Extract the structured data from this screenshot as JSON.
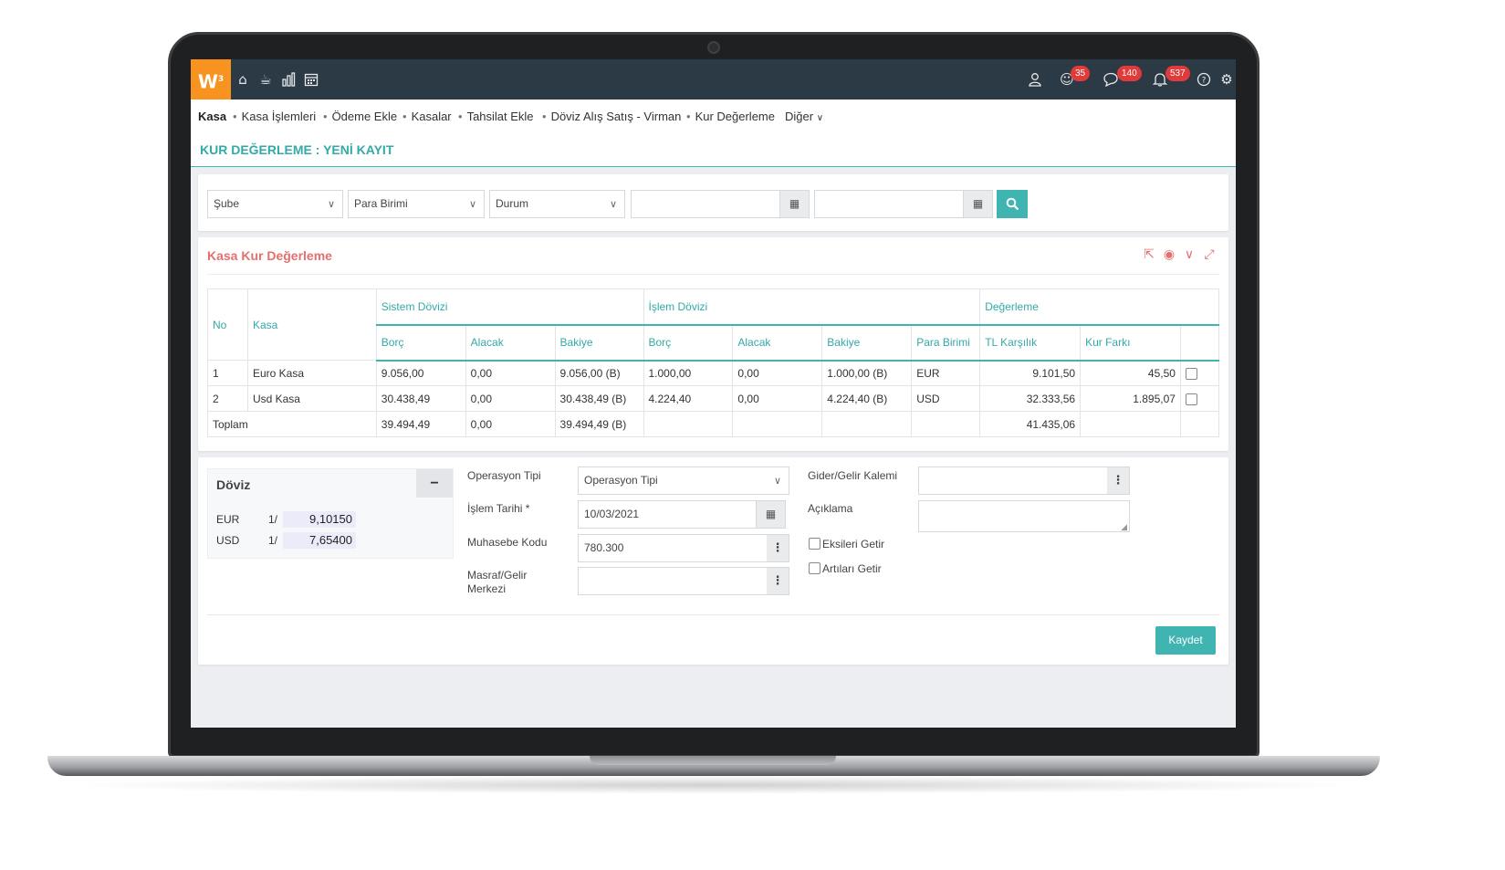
{
  "topbar": {
    "logo": "W",
    "logo_sup": "3",
    "left_icons": [
      "home-icon",
      "cup-icon",
      "chart-icon",
      "calendar-icon"
    ],
    "right_icons": [
      "user-icon",
      "smile-icon",
      "chat-icon",
      "bell-icon",
      "help-icon",
      "gear-icon"
    ],
    "badges": {
      "smile": "35",
      "chat": "140",
      "bell": "537"
    },
    "bg_color": "#2c3a45",
    "logo_color": "#f7931e"
  },
  "menu": {
    "items": [
      "Kasa",
      "Kasa İşlemleri",
      "Ödeme Ekle",
      "Kasalar",
      "Tahsilat Ekle",
      "Döviz Alış Satış - Virman",
      "Kur Değerleme",
      "Diğer"
    ]
  },
  "page": {
    "title": "KUR DEĞERLEME : YENİ KAYIT",
    "accent": "#3fb4b0"
  },
  "filters": {
    "sube": "Şube",
    "para_birimi": "Para Birimi",
    "durum": "Durum",
    "date1": "",
    "date2": ""
  },
  "table_section": {
    "title": "Kasa Kur Değerleme",
    "title_color": "#e46f6f",
    "icons": [
      "export-icon",
      "eye-icon",
      "chevron-down-icon",
      "expand-icon"
    ],
    "headers": {
      "no": "No",
      "kasa": "Kasa",
      "group_sistem": "Sistem Dövizi",
      "group_islem": "İşlem Dövizi",
      "group_degerleme": "Değerleme",
      "borc": "Borç",
      "alacak": "Alacak",
      "bakiye": "Bakiye",
      "borc2": "Borç",
      "alacak2": "Alacak",
      "bakiye2": "Bakiye",
      "para_birimi": "Para Birimi",
      "tl_karsilik": "TL Karşılık",
      "kur_farki": "Kur Farkı"
    },
    "rows": [
      {
        "no": "1",
        "kasa": "Euro Kasa",
        "s_borc": "9.056,00",
        "s_alacak": "0,00",
        "s_bakiye": "9.056,00 (B)",
        "i_borc": "1.000,00",
        "i_alacak": "0,00",
        "i_bakiye": "1.000,00 (B)",
        "para": "EUR",
        "tl": "9.101,50",
        "kur": "45,50"
      },
      {
        "no": "2",
        "kasa": "Usd Kasa",
        "s_borc": "30.438,49",
        "s_alacak": "0,00",
        "s_bakiye": "30.438,49 (B)",
        "i_borc": "4.224,40",
        "i_alacak": "0,00",
        "i_bakiye": "4.224,40 (B)",
        "para": "USD",
        "tl": "32.333,56",
        "kur": "1.895,07"
      }
    ],
    "total": {
      "label": "Toplam",
      "s_borc": "39.494,49",
      "s_alacak": "0,00",
      "s_bakiye": "39.494,49 (B)",
      "tl": "41.435,06"
    }
  },
  "doviz": {
    "title": "Döviz",
    "minus": "−",
    "rates": [
      {
        "cur": "EUR",
        "one": "1/",
        "val": "9,10150"
      },
      {
        "cur": "USD",
        "one": "1/",
        "val": "7,65400"
      }
    ]
  },
  "form": {
    "operasyon_label": "Operasyon Tipi",
    "operasyon_value": "Operasyon Tipi",
    "tarih_label": "İşlem Tarihi *",
    "tarih_value": "10/03/2021",
    "muhasebe_label": "Muhasebe Kodu",
    "muhasebe_value": "780.300",
    "masraf_label_1": "Masraf/Gelir",
    "masraf_label_2": "Merkezi",
    "masraf_value": "",
    "gider_label": "Gider/Gelir Kalemi",
    "gider_value": "",
    "aciklama_label": "Açıklama",
    "aciklama_value": "",
    "eksileri": "Eksileri Getir",
    "artilari": "Artıları Getir",
    "save": "Kaydet"
  }
}
